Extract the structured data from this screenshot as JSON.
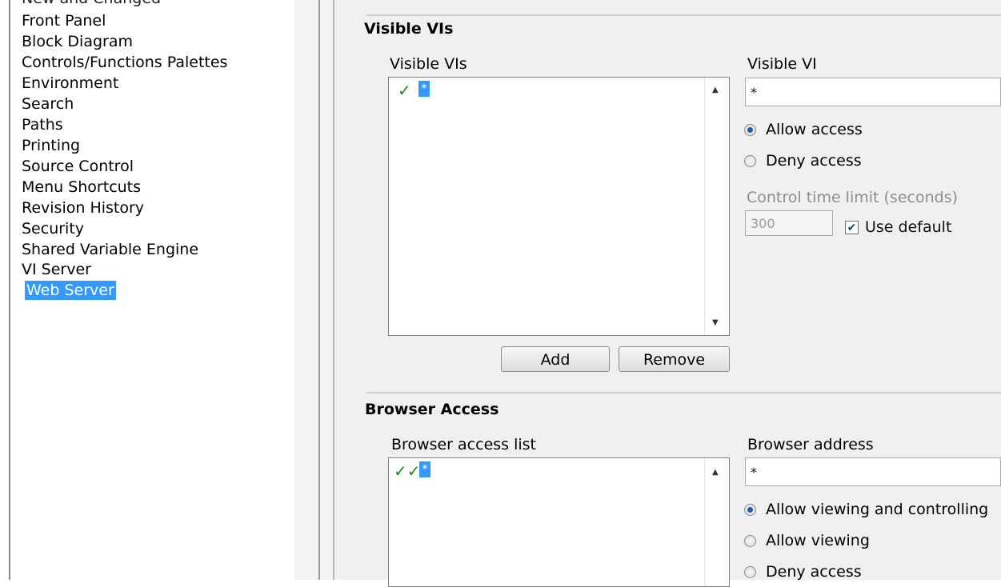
{
  "categories": [
    {
      "label": "New and Changed",
      "partial": true
    },
    {
      "label": "Front Panel"
    },
    {
      "label": "Block Diagram"
    },
    {
      "label": "Controls/Functions Palettes"
    },
    {
      "label": "Environment"
    },
    {
      "label": "Search"
    },
    {
      "label": "Paths"
    },
    {
      "label": "Printing"
    },
    {
      "label": "Source Control"
    },
    {
      "label": "Menu Shortcuts"
    },
    {
      "label": "Revision History"
    },
    {
      "label": "Security"
    },
    {
      "label": "Shared Variable Engine"
    },
    {
      "label": "VI Server"
    },
    {
      "label": "Web Server",
      "selected": true
    }
  ],
  "visible_vis": {
    "section_title": "Visible VIs",
    "list_label": "Visible VIs",
    "list_items": [
      {
        "mark": "✓",
        "text": "*"
      }
    ],
    "field_label": "Visible VI",
    "field_value": "*",
    "allow_label": "Allow access",
    "deny_label": "Deny access",
    "allow_selected": true,
    "time_limit_label": "Control time limit (seconds)",
    "time_limit_value": "300",
    "use_default_label": "Use default",
    "use_default_checked": true,
    "add_label": "Add",
    "remove_label": "Remove"
  },
  "browser_access": {
    "section_title": "Browser Access",
    "list_label": "Browser access list",
    "list_items": [
      {
        "mark": "✓✓",
        "text": "*"
      }
    ],
    "field_label": "Browser address",
    "field_value": "*",
    "options": [
      {
        "label": "Allow viewing and controlling",
        "selected": true
      },
      {
        "label": "Allow viewing",
        "selected": false
      },
      {
        "label": "Deny access",
        "selected": false
      }
    ]
  },
  "icons": {
    "check": "check-icon",
    "double_check": "double-check-icon",
    "scroll_up": "scroll-up-arrow-icon",
    "scroll_down": "scroll-down-arrow-icon"
  },
  "colors": {
    "selection": "#3399ff",
    "check": "#1e8a1e",
    "panel_bg": "#f0f0f0"
  }
}
